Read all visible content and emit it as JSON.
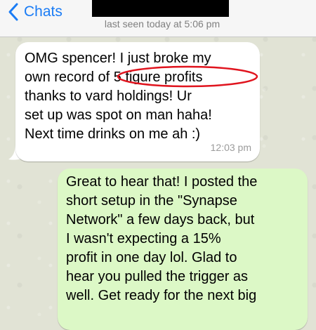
{
  "header": {
    "back_label": "Chats",
    "last_seen": "last seen today at 5:06 pm"
  },
  "messages": [
    {
      "direction": "incoming",
      "text": "OMG spencer! I just broke my\nown record of 5 figure profits\nthanks to vard holdings! Ur\nset up was spot on man haha!\nNext time drinks on me ah :)",
      "time": "12:03 pm"
    },
    {
      "direction": "outgoing",
      "text": "Great to hear that! I posted the\nshort setup in the \"Synapse\nNetwork\" a few days back, but\nI wasn't expecting a 15%\nprofit in one day lol. Glad to\nhear you pulled the trigger as\nwell. Get ready for the next big"
    }
  ],
  "colors": {
    "accent": "#1a7cf5",
    "incoming_bubble": "#ffffff",
    "outgoing_bubble": "#dcf8c6",
    "annotation": "#e0141e"
  },
  "icons": {
    "back": "chevron-left-icon"
  }
}
